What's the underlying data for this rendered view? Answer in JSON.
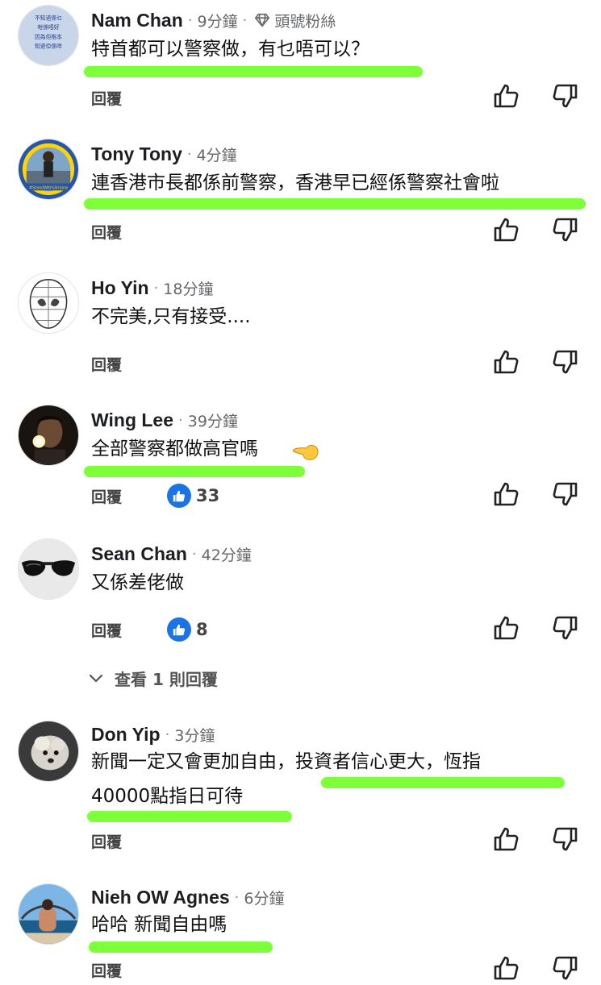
{
  "comments": [
    {
      "author": "Nam Chan",
      "time": "9分鐘",
      "fan_label": "頭號粉絲",
      "lines": [
        "特首都可以警察做，有乜唔可以？"
      ],
      "reply": "回覆"
    },
    {
      "author": "Tony Tony",
      "time": "4分鐘",
      "lines": [
        "連香港市長都係前警察，香港早已經係警察社會啦"
      ],
      "reply": "回覆"
    },
    {
      "author": "Ho Yin",
      "time": "18分鐘",
      "lines": [
        "不完美,只有接受...."
      ],
      "reply": "回覆"
    },
    {
      "author": "Wing Lee",
      "time": "39分鐘",
      "lines": [
        "全部警察都做高官嗎"
      ],
      "reply": "回覆",
      "reactions": "33"
    },
    {
      "author": "Sean Chan",
      "time": "42分鐘",
      "lines": [
        "又係差佬做"
      ],
      "reply": "回覆",
      "reactions": "8"
    },
    {
      "author": "Don Yip",
      "time": "3分鐘",
      "lines": [
        "新聞一定又會更加自由，投資者信心更大，恆指",
        "40000點指日可待"
      ],
      "reply": "回覆"
    },
    {
      "author": "Nieh OW Agnes",
      "time": "6分鐘",
      "lines": [
        "哈哈 新聞自由嗎"
      ],
      "reply": "回覆"
    }
  ],
  "avatar1_text": [
    "不知道係乜",
    "咁係唔好",
    "因為佢根本",
    "知道佢係咩"
  ],
  "avatar2_text": "#StandWithUkraine",
  "view_replies": "查看 1 則回覆",
  "colors": {
    "highlight": "#7dff3a",
    "like_blue": "#1b74e4",
    "meta_grey": "#65676b"
  }
}
